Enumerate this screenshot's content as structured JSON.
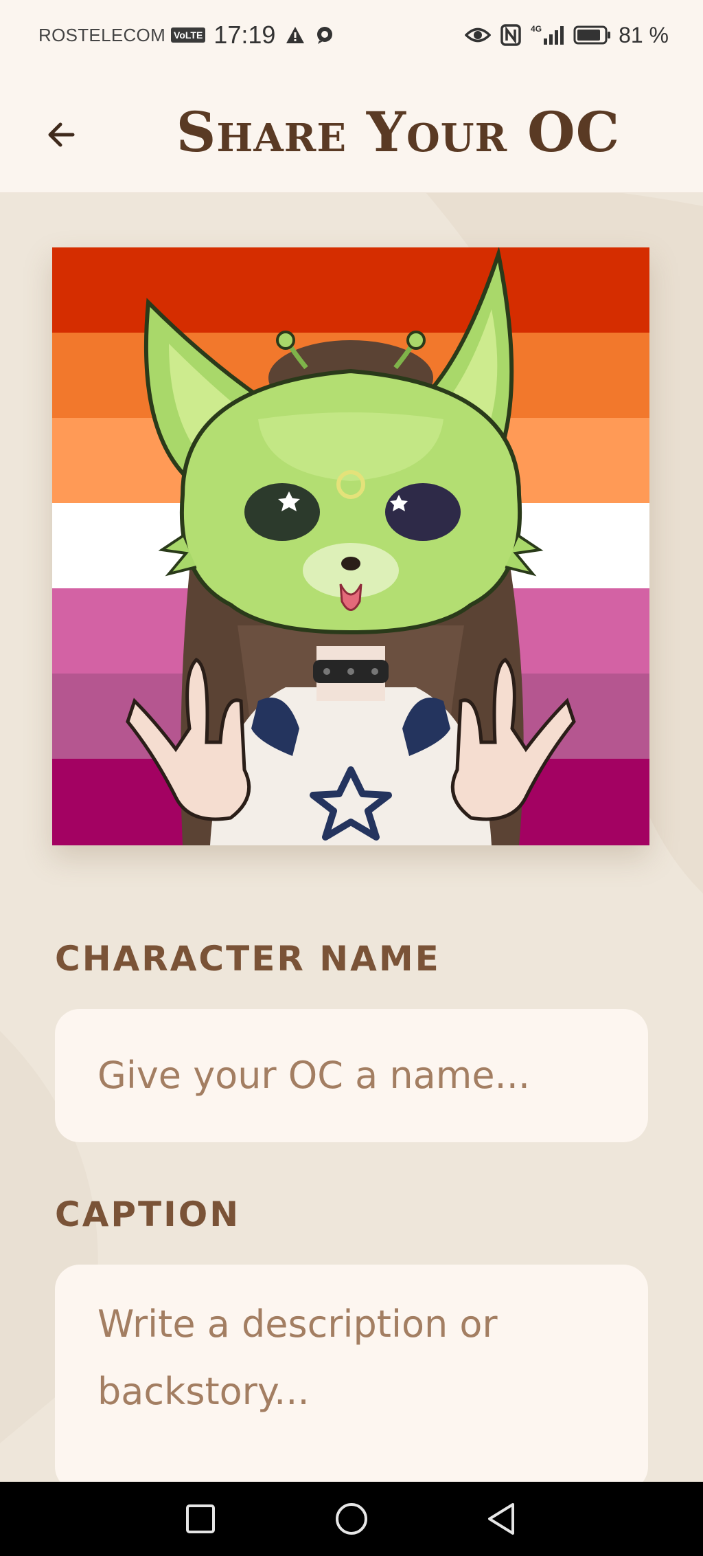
{
  "status_bar": {
    "carrier": "ROSTELECOM",
    "volte": "VoLTE",
    "time": "17:19",
    "network": "4G",
    "battery_pct": "81 %",
    "icons": [
      "warning-icon",
      "chat-bubble-icon",
      "eye-icon",
      "nfc-icon",
      "signal-icon",
      "battery-icon"
    ]
  },
  "header": {
    "title": "Share Your OC",
    "back_icon": "arrow-left-icon"
  },
  "image": {
    "subject": "uploaded OC artwork",
    "flag_colors": [
      "#D52D00",
      "#F2782C",
      "#FF9A56",
      "#FFFFFF",
      "#D362A4",
      "#B55690",
      "#A30262"
    ]
  },
  "form": {
    "name_label": "CHARACTER NAME",
    "name_placeholder": "Give your OC a name...",
    "caption_label": "CAPTION",
    "caption_placeholder": "Write a description or backstory..."
  },
  "nav": {
    "recent_icon": "square-icon",
    "home_icon": "circle-icon",
    "back_icon": "triangle-back-icon"
  },
  "colors": {
    "background": "#EEE6DA",
    "header_bg": "#FBF5EF",
    "title": "#5A3A24",
    "label": "#7A5337",
    "placeholder": "#A37E62",
    "input_bg": "#FDF6F0"
  }
}
